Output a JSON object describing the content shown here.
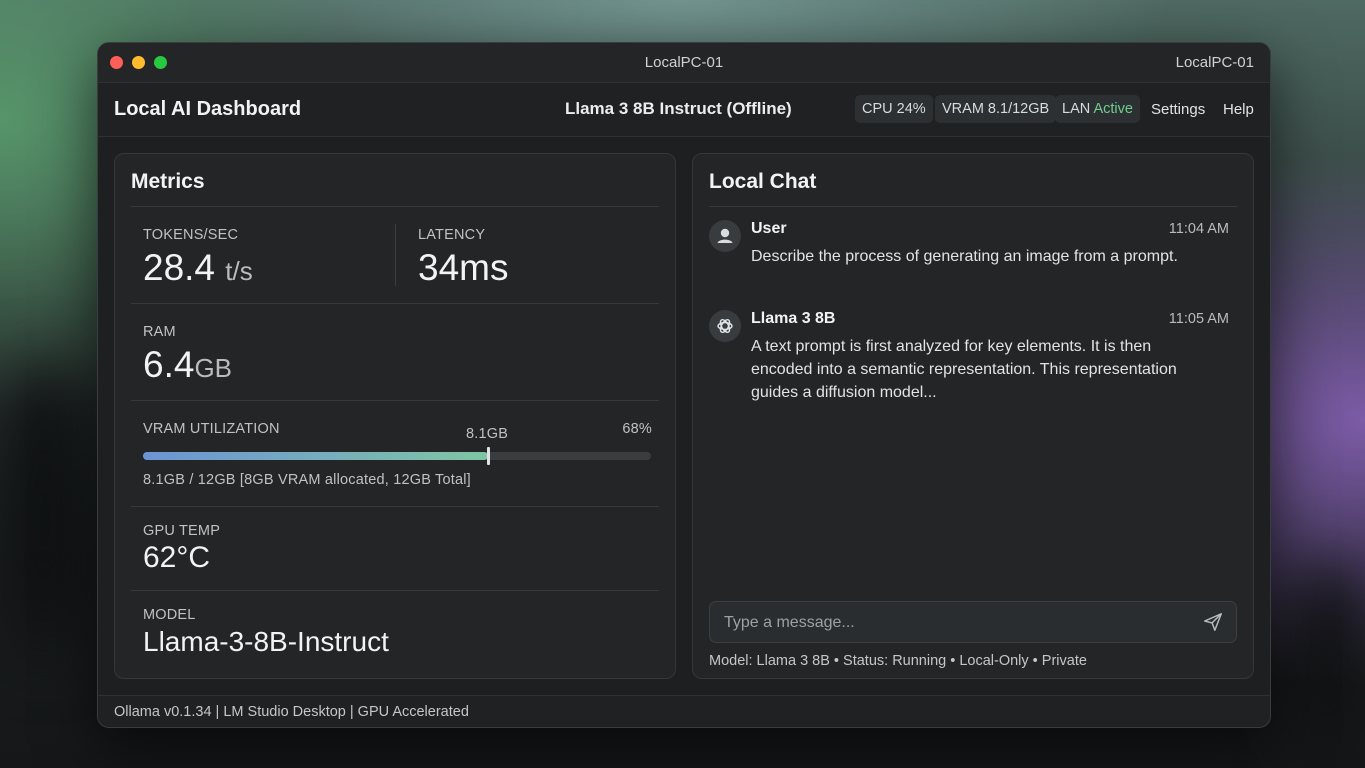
{
  "window": {
    "title_center": "LocalPC-01",
    "title_right": "LocalPC-01"
  },
  "header": {
    "app_title": "Local AI Dashboard",
    "model_title": "Llama 3 8B Instruct (Offline)",
    "chips": {
      "cpu": "CPU 24%",
      "vram": "VRAM 8.1/12GB",
      "lan_prefix": "LAN",
      "lan_status": "Active"
    },
    "links": {
      "settings": "Settings",
      "help": "Help"
    }
  },
  "metrics": {
    "title": "Metrics",
    "tokens": {
      "label": "TOKENS/SEC",
      "value": "28.4",
      "unit": "t/s"
    },
    "latency": {
      "label": "LATENCY",
      "value": "34ms"
    },
    "ram": {
      "label": "RAM",
      "value": "6.4",
      "unit": "GB"
    },
    "vram": {
      "label": "VRAM UTILIZATION",
      "marker_label": "8.1GB",
      "percent_label": "68%",
      "fill_fraction": 0.68,
      "detail": "8.1GB / 12GB [8GB VRAM allocated, 12GB Total]"
    },
    "gpu_temp": {
      "label": "GPU TEMP",
      "value": "62°C"
    },
    "model": {
      "label": "MODEL",
      "value": "Llama-3-8B-Instruct"
    }
  },
  "chat": {
    "title": "Local Chat",
    "messages": [
      {
        "sender": "User",
        "time": "11:04 AM",
        "text": "Describe the process of generating an image from a prompt.",
        "icon": "user-icon"
      },
      {
        "sender": "Llama 3 8B",
        "time": "11:05 AM",
        "text": "A text prompt is first analyzed for key elements. It is then encoded into a semantic representation. This representation guides a diffusion model...",
        "icon": "openai-logo-icon"
      }
    ],
    "input_placeholder": "Type a message...",
    "status": "Model: Llama 3 8B • Status: Running • Local-Only • Private"
  },
  "footer": {
    "text": "Ollama v0.1.34 | LM Studio Desktop | GPU Accelerated"
  },
  "colors": {
    "accent_green": "#6fce8d",
    "bar_start": "#6b94d6",
    "bar_end": "#7fc6a4"
  }
}
